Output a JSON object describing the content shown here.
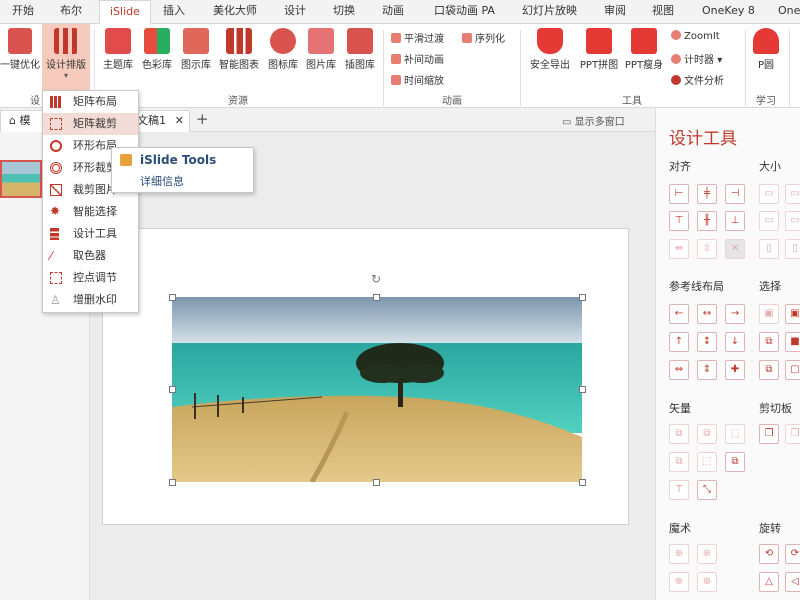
{
  "tabs": [
    "开始",
    "布尔",
    "iSlide",
    "插入",
    "美化大师",
    "设计",
    "切换",
    "动画",
    "口袋动画 PA",
    "幻灯片放映",
    "审阅",
    "视图",
    "OneKey 8",
    "One"
  ],
  "ribbon": {
    "btn_optimize": "一键优化",
    "btn_layout": "设计排版",
    "btn_theme": "主题库",
    "btn_color": "色彩库",
    "btn_diagram": "图示库",
    "btn_chart": "智能图表",
    "btn_icon": "图标库",
    "btn_picture": "图片库",
    "btn_illus": "插图库",
    "anim_smooth": "平滑过渡",
    "anim_seq": "序列化",
    "anim_tween": "补间动画",
    "anim_zoom": "时间缩放",
    "btn_export": "安全导出",
    "btn_puzzle": "PPT拼图",
    "btn_slim": "PPT瘦身",
    "tool_zoomit": "ZoomIt",
    "tool_timer": "计时器",
    "tool_analyze": "文件分析",
    "btn_pyuan": "P圆",
    "grp_design": "设",
    "grp_resource": "资源",
    "grp_anim": "动画",
    "grp_tools": "工具",
    "grp_learn": "学习"
  },
  "doc": {
    "tab1": "模",
    "tab2": "文稿1",
    "show_multi": "显示多窗口",
    "thumb_num": "1"
  },
  "menu": [
    "矩阵布局",
    "矩阵裁剪",
    "环形布局",
    "环形裁剪",
    "裁剪图片",
    "智能选择",
    "设计工具",
    "取色器",
    "控点调节",
    "增删水印"
  ],
  "flyout": {
    "title": "iSlide Tools",
    "sub": "详细信息"
  },
  "pane": {
    "title": "设计工具",
    "align": "对齐",
    "size": "大小",
    "guide": "参考线布局",
    "select": "选择",
    "vector": "矢量",
    "clip": "剪切板",
    "magic": "魔术",
    "rotate": "旋转"
  },
  "colors": {
    "accent": "#c0392b",
    "menu_highlight": "#f3dcd6"
  }
}
